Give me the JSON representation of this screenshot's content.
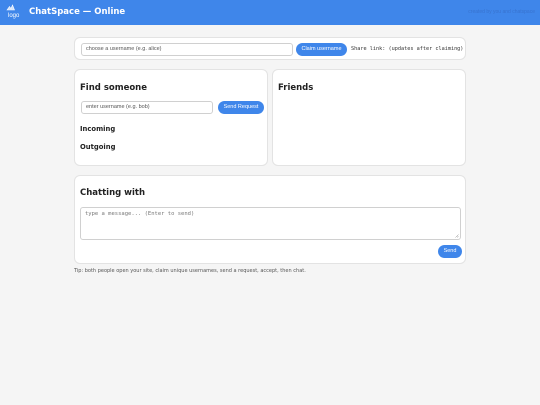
{
  "header": {
    "logo_text": "logo",
    "title": "ChatSpace — Online",
    "right_text": "created by you and chatspace"
  },
  "user": {
    "username_placeholder": "choose a username (e.g. alice)",
    "claim_label": "Claim username",
    "share_link": "Share link: (updates after claiming)"
  },
  "find": {
    "heading": "Find someone",
    "target_placeholder": "enter username (e.g. bob)",
    "send_request_label": "Send Request",
    "incoming_heading": "Incoming",
    "outgoing_heading": "Outgoing"
  },
  "friends": {
    "heading": "Friends"
  },
  "chat": {
    "heading": "Chatting with",
    "message_placeholder": "type a message... (Enter to send)",
    "send_label": "Send"
  },
  "tip": "Tip: both people open your site, claim unique usernames, send a request, accept, then chat.",
  "colors": {
    "accent": "#3f86ea",
    "background": "#f5f5f5",
    "card": "#ffffff"
  },
  "icons": {
    "logo": "broken-image-icon",
    "resize": "resize-grip-icon"
  }
}
